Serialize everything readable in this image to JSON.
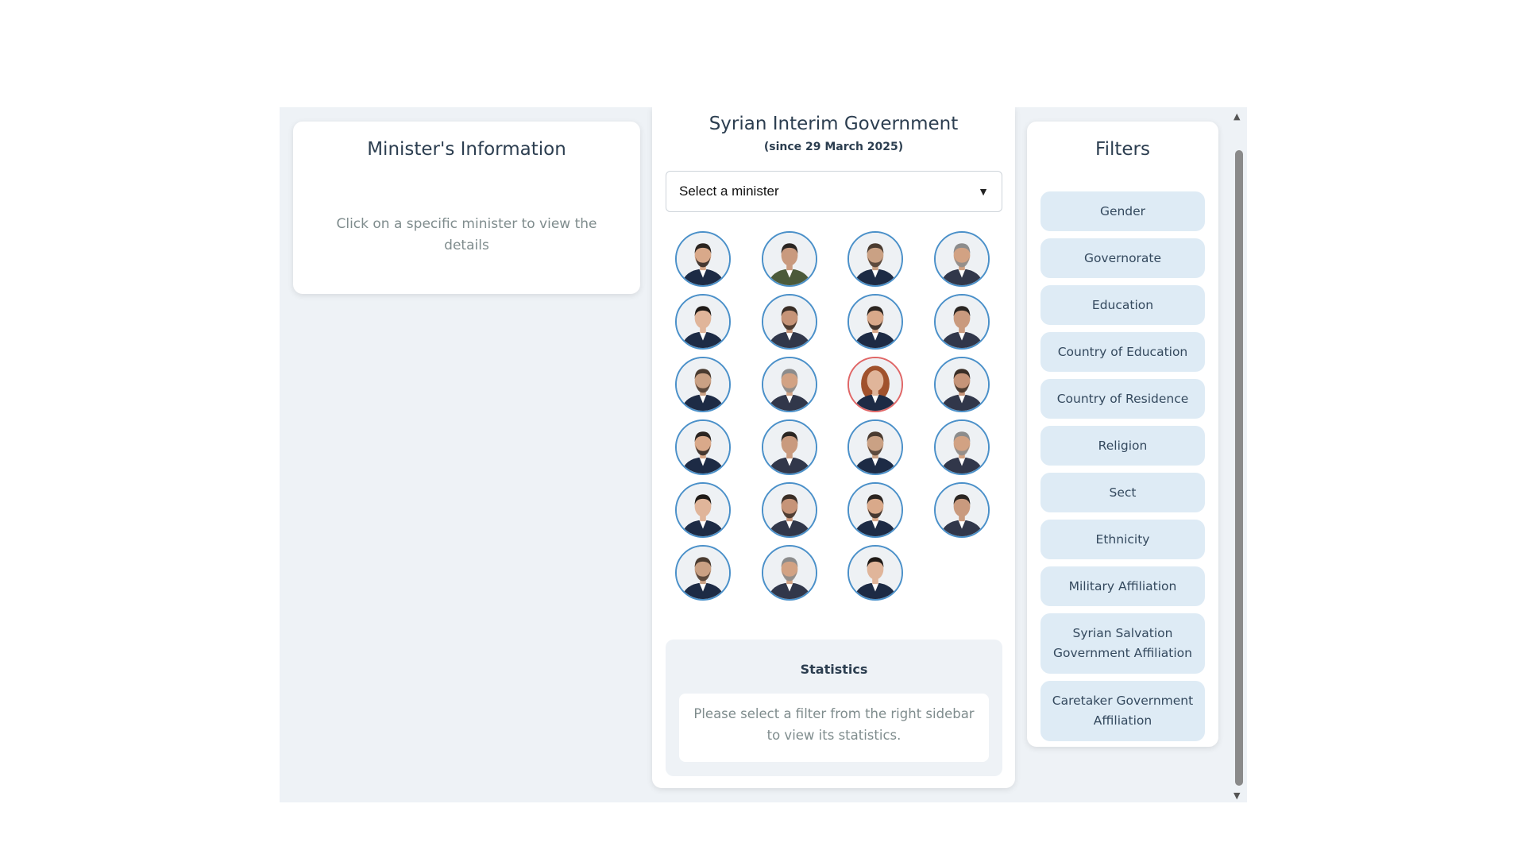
{
  "left_panel": {
    "title": "Minister's Information",
    "hint": "Click on a specific minister to view the details"
  },
  "center_panel": {
    "title": "Syrian Interim Government",
    "subtitle": "(since 29 March 2025)",
    "select": {
      "selected": "Select a minister"
    },
    "ministers_count": 23,
    "statistics": {
      "title": "Statistics",
      "message": "Please select a filter from the right sidebar to view its statistics."
    }
  },
  "filters": {
    "title": "Filters",
    "items": [
      "Gender",
      "Governorate",
      "Education",
      "Country of Education",
      "Country of Residence",
      "Religion",
      "Sect",
      "Ethnicity",
      "Military Affiliation",
      "Syrian Salvation Government Affiliation",
      "Caretaker Government Affiliation"
    ]
  },
  "colors": {
    "panel_background": "#eef2f6",
    "filter_button": "#deebf5",
    "avatar_border": "#4a90c9",
    "avatar_border_female": "#e06666",
    "heading_text": "#2c3e50",
    "muted_text": "#7f8c8d"
  }
}
